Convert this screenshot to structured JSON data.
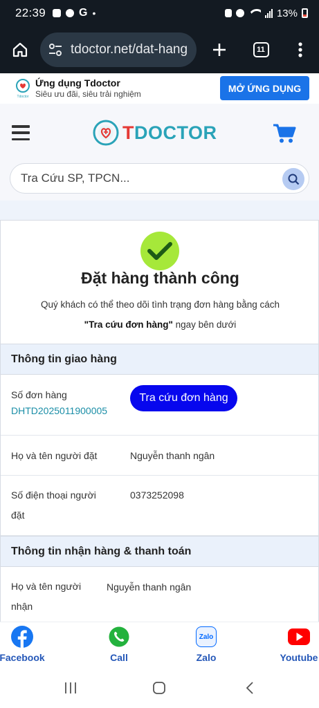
{
  "status_bar": {
    "time": "22:39",
    "battery": "13%"
  },
  "browser": {
    "url": "tdoctor.net/dat-hang",
    "tab_count": "11"
  },
  "app_banner": {
    "title": "Ứng dụng Tdoctor",
    "subtitle": "Siêu ưu đãi, siêu trải nghiệm",
    "button": "MỞ ỨNG DỤNG",
    "logo_text": "Tdoctor"
  },
  "header": {
    "logo_t": "T",
    "logo_rest": "DOCTOR"
  },
  "search": {
    "placeholder": "Tra Cứu SP, TPCN..."
  },
  "success": {
    "title": "Đặt hàng thành công",
    "message": "Quý khách có thể theo dõi tình trạng đơn hàng bằng cách",
    "link_text": "\"Tra cứu đơn hàng\"",
    "message_tail": " ngay bên dưới"
  },
  "delivery": {
    "heading": "Thông tin giao hàng",
    "order_label": "Số đơn hàng",
    "order_code": "DHTD2025011900005",
    "track_button": "Tra cứu đơn hàng",
    "name_label": "Họ và tên người đặt",
    "name_value": "Nguyễn thanh ngân",
    "phone_label_1": "Số điện thoại người",
    "phone_label_2": "đặt",
    "phone_value": "0373252098"
  },
  "receiving": {
    "heading": "Thông tin nhận hàng & thanh toán",
    "name_label_1": "Họ và tên người",
    "name_label_2": "nhận",
    "name_value": "Nguyễn thanh ngân"
  },
  "social": {
    "facebook": "Facebook",
    "call": "Call",
    "zalo": "Zalo",
    "zalo_icon_text": "Zalo",
    "youtube": "Youtube"
  },
  "colors": {
    "brand_blue": "#1a73e8",
    "track_button": "#0707ee",
    "success_green": "#a6e83a",
    "link_teal": "#1b8ea7"
  }
}
